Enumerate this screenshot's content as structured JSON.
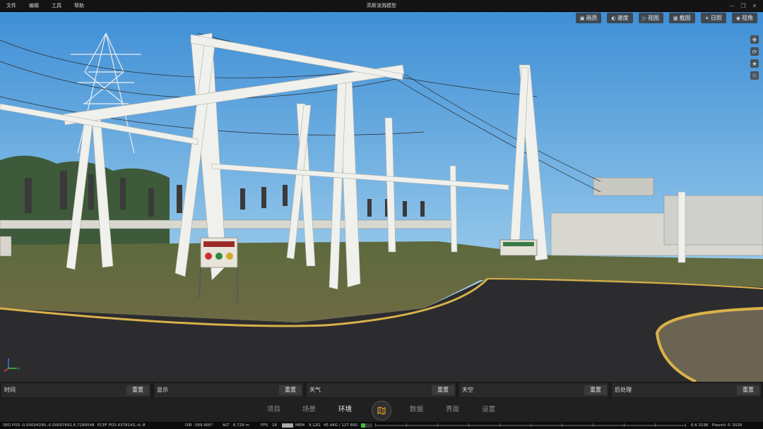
{
  "titlebar": {
    "menu": [
      "文件",
      "编辑",
      "工具",
      "帮助"
    ],
    "title": "高斯泼溅模型",
    "controls": [
      "minimize-icon",
      "restore-icon",
      "close-icon"
    ]
  },
  "toolbar": {
    "buttons": [
      {
        "icon": "image-icon",
        "label": "画质"
      },
      {
        "icon": "speedometer-icon",
        "label": "速度"
      },
      {
        "icon": "video-camera-icon",
        "label": "视图"
      },
      {
        "icon": "screenshot-icon",
        "label": "截图"
      },
      {
        "icon": "sun-icon",
        "label": "日照"
      },
      {
        "icon": "eye-icon",
        "label": "视角"
      }
    ]
  },
  "side_tools": [
    "move-icon",
    "orbit-icon",
    "person-icon",
    "globe-icon"
  ],
  "axis": {
    "x": "X",
    "y": "Y",
    "z": "Z"
  },
  "panels": [
    {
      "label": "时间",
      "reset": "重置"
    },
    {
      "label": "显示",
      "reset": "重置"
    },
    {
      "label": "天气",
      "reset": "重置"
    },
    {
      "label": "天空",
      "reset": "重置"
    },
    {
      "label": "后处理",
      "reset": "重置"
    }
  ],
  "tabs": {
    "left": [
      "项目",
      "场景",
      "环境"
    ],
    "right": [
      "数据",
      "界面",
      "设置"
    ],
    "active": "环境",
    "center_icon": "map-icon"
  },
  "status": {
    "geo_pos": "SEO POS  -0.00004290,-0.00007691,6.7289548",
    "ecef_pos": "ECEF POS  6378143,-4,-8",
    "dir_label": "DIR",
    "dir_value": "069.900°",
    "alt_label": "ALT",
    "alt_value": "6.729 m",
    "fps_label": "FPS",
    "fps_value": "16",
    "mem_label": "MEM",
    "mem_value": "9.12G",
    "mem_total": "45.44G / 127.89G",
    "mem_fraction": 0.36,
    "version": "6.6.3198",
    "copyright": "Piaoshi © 2026",
    "accent": "#3fbf3f"
  }
}
